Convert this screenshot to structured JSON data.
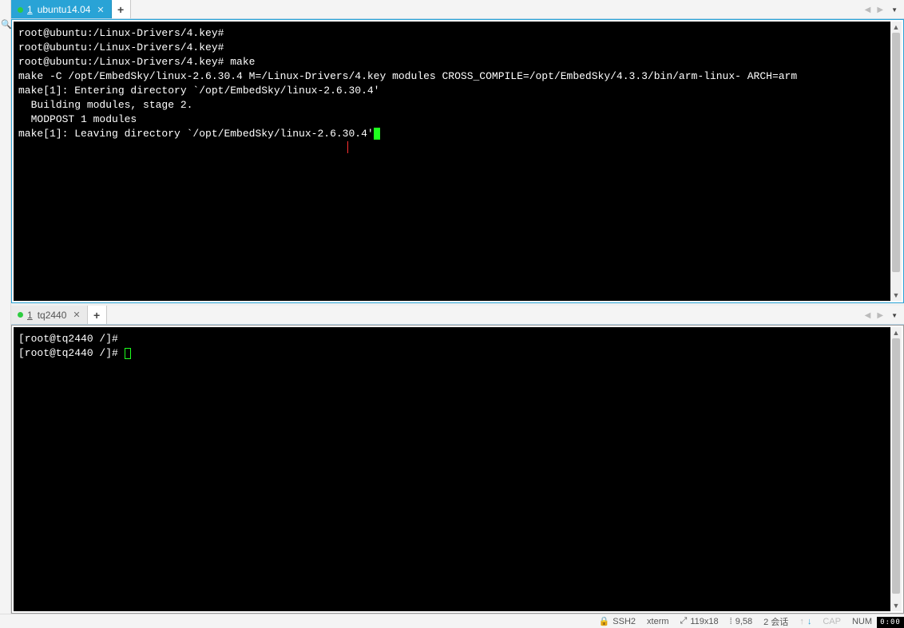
{
  "panes": {
    "top": {
      "tab": {
        "index": "1",
        "title": "ubuntu14.04"
      },
      "lines": [
        "root@ubuntu:/Linux-Drivers/4.key#",
        "root@ubuntu:/Linux-Drivers/4.key#",
        "root@ubuntu:/Linux-Drivers/4.key# make",
        "make -C /opt/EmbedSky/linux-2.6.30.4 M=/Linux-Drivers/4.key modules CROSS_COMPILE=/opt/EmbedSky/4.3.3/bin/arm-linux- ARCH=arm",
        "make[1]: Entering directory `/opt/EmbedSky/linux-2.6.30.4'",
        "  Building modules, stage 2.",
        "  MODPOST 1 modules",
        "make[1]: Leaving directory `/opt/EmbedSky/linux-2.6.30.4'"
      ]
    },
    "bottom": {
      "tab": {
        "index": "1",
        "title": "tq2440"
      },
      "lines": [
        "[root@tq2440 /]#",
        "[root@tq2440 /]# "
      ]
    }
  },
  "statusbar": {
    "protocol": "SSH2",
    "term": "xterm",
    "size": "119x18",
    "cursor": "9,58",
    "sessions": "2 会话",
    "caps": "CAP",
    "num": "NUM"
  },
  "clock": "0:00"
}
